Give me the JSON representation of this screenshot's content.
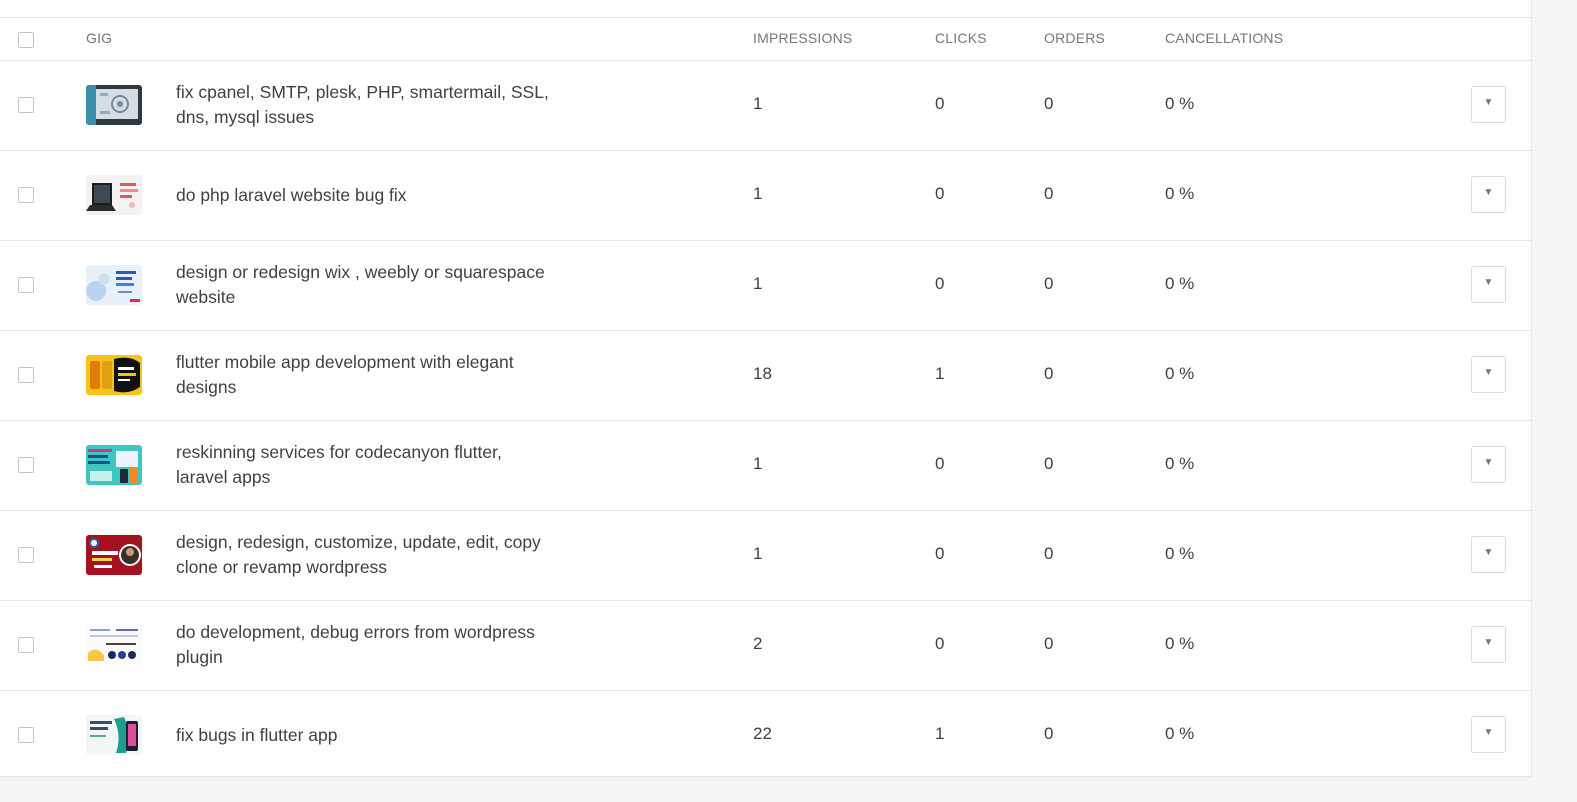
{
  "headers": {
    "gig": "GIG",
    "impressions": "IMPRESSIONS",
    "clicks": "CLICKS",
    "orders": "ORDERS",
    "cancellations": "CANCELLATIONS"
  },
  "dropdown_glyph": "▼",
  "rows": [
    {
      "title": "fix cpanel, SMTP, plesk, PHP, smartermail, SSL, dns, mysql issues",
      "impressions": "1",
      "clicks": "0",
      "orders": "0",
      "cancellations": "0 %",
      "thumb": "server-gear-thumbnail"
    },
    {
      "title": "do php laravel website bug fix",
      "impressions": "1",
      "clicks": "0",
      "orders": "0",
      "cancellations": "0 %",
      "thumb": "laptop-thumbnail"
    },
    {
      "title": "design or redesign wix , weebly or squarespace website",
      "impressions": "1",
      "clicks": "0",
      "orders": "0",
      "cancellations": "0 %",
      "thumb": "blue-web-thumbnail"
    },
    {
      "title": "flutter mobile app development with elegant designs",
      "impressions": "18",
      "clicks": "1",
      "orders": "0",
      "cancellations": "0 %",
      "thumb": "yellow-phones-thumbnail"
    },
    {
      "title": "reskinning services for codecanyon flutter, laravel apps",
      "impressions": "1",
      "clicks": "0",
      "orders": "0",
      "cancellations": "0 %",
      "thumb": "teal-apps-thumbnail"
    },
    {
      "title": "design, redesign, customize, update, edit, copy clone or revamp wordpress",
      "impressions": "1",
      "clicks": "0",
      "orders": "0",
      "cancellations": "0 %",
      "thumb": "red-wordpress-thumbnail"
    },
    {
      "title": "do development, debug errors from wordpress plugin",
      "impressions": "2",
      "clicks": "0",
      "orders": "0",
      "cancellations": "0 %",
      "thumb": "plugin-thumbnail"
    },
    {
      "title": "fix bugs in flutter app",
      "impressions": "22",
      "clicks": "1",
      "orders": "0",
      "cancellations": "0 %",
      "thumb": "flutter-bugs-thumbnail"
    }
  ]
}
